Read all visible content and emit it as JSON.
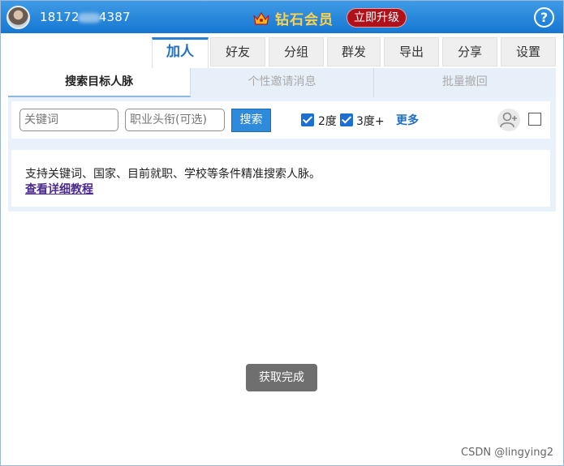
{
  "header": {
    "phone_prefix": "18172",
    "phone_suffix": "4387",
    "vip_label": "钻石会员",
    "upgrade_label": "立即升级",
    "help_label": "?"
  },
  "main_tabs": [
    {
      "label": "加人",
      "active": true
    },
    {
      "label": "好友",
      "active": false
    },
    {
      "label": "分组",
      "active": false
    },
    {
      "label": "群发",
      "active": false
    },
    {
      "label": "导出",
      "active": false
    },
    {
      "label": "分享",
      "active": false
    },
    {
      "label": "设置",
      "active": false
    }
  ],
  "sub_tabs": [
    {
      "label": "搜索目标人脉",
      "active": true
    },
    {
      "label": "个性邀请消息",
      "active": false
    },
    {
      "label": "批量撤回",
      "active": false
    }
  ],
  "search": {
    "keyword_placeholder": "关键词",
    "title_placeholder": "职业头衔(可选)",
    "search_label": "搜索",
    "degree2_label": "2度",
    "degree3_label": "3度+",
    "more_label": "更多"
  },
  "info": {
    "text": "支持关键词、国家、目前就职、学校等条件精准搜索人脉。",
    "link": "查看详细教程"
  },
  "toast": "获取完成",
  "watermark": "CSDN @lingying2",
  "colors": {
    "accent": "#2e8bdc",
    "header": "#1677d2",
    "upgrade": "#b0101a",
    "vip_gold": "#ffd24a"
  }
}
